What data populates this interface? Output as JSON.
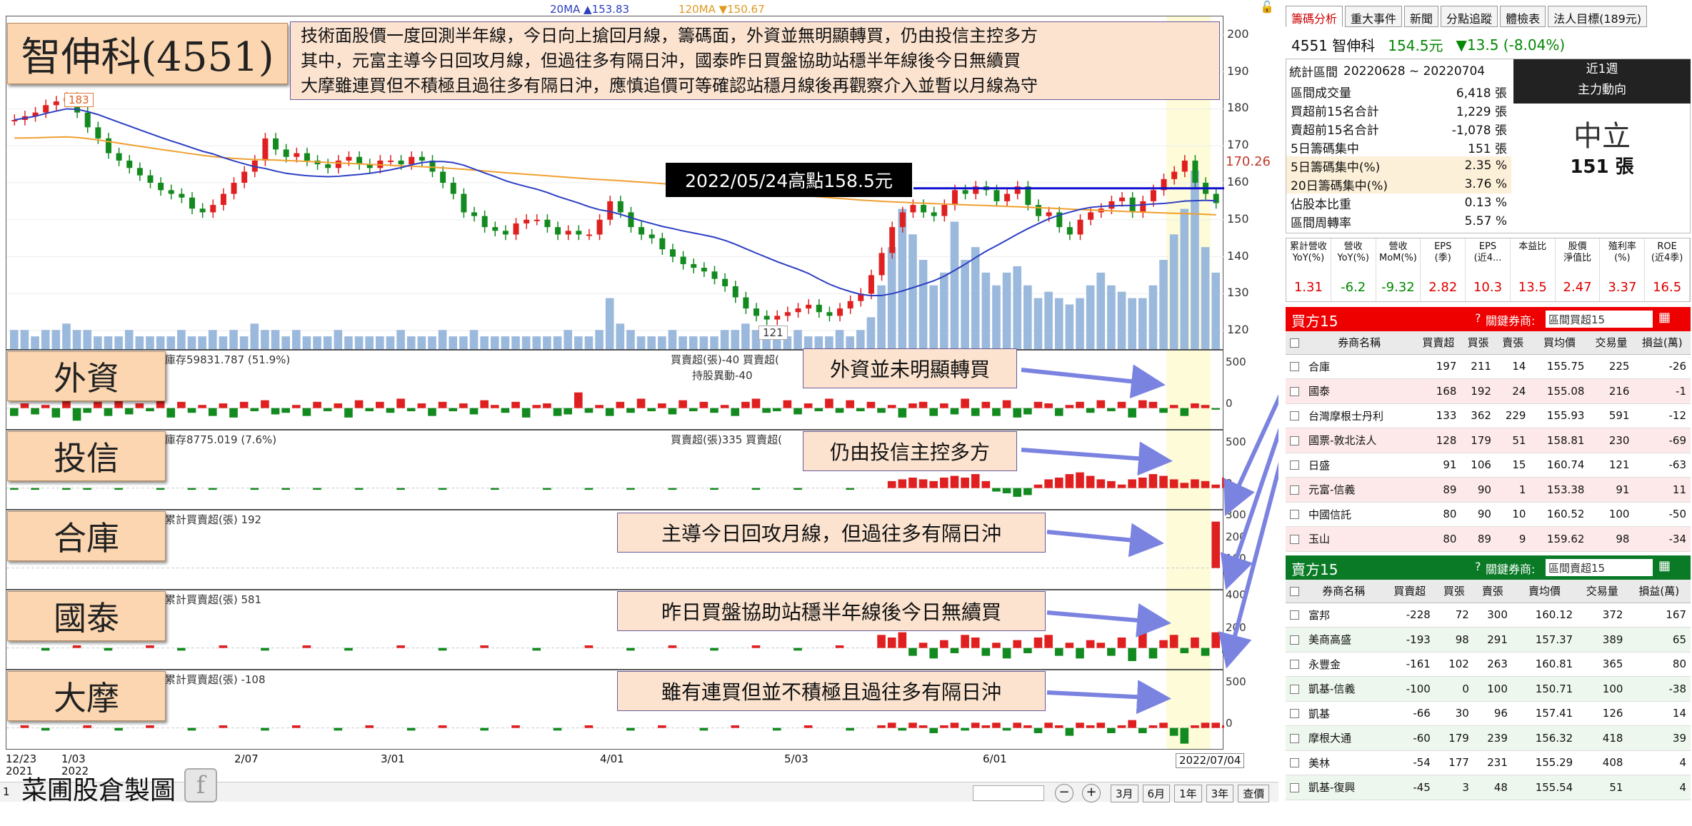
{
  "title": "智伸科(4551)",
  "commentary": [
    "技術面股價一度回測半年線，今日向上搶回月線，籌碼面，外資並無明顯轉買，仍由投信主控多方",
    "其中，元富主導今日回攻月線，但過往多有隔日沖，國泰昨日買盤協助站穩半年線後今日無續買",
    "大摩雖連買但不積極且過往多有隔日沖，應慎追價可等確認站穩月線後再觀察介入並暫以月線為守"
  ],
  "ma_legend": {
    "ma20": "20MA ▲153.83",
    "ma120": "120MA ▼150.67"
  },
  "high_label": "2022/05/24高點158.5元",
  "last_price_tag": "170.26",
  "peak_label": "183",
  "low_label": "121",
  "price_axis": [
    "200",
    "190",
    "180",
    "170",
    "160",
    "150",
    "140",
    "130",
    "120"
  ],
  "date_labels": [
    {
      "d": "12/23\n2021"
    },
    {
      "d": "1/03\n2022"
    },
    {
      "d": "2/07"
    },
    {
      "d": "3/01"
    },
    {
      "d": "4/01"
    },
    {
      "d": "5/03"
    },
    {
      "d": "6/01"
    },
    {
      "d": "2022/07/04"
    }
  ],
  "panels": [
    {
      "badge": "外資",
      "info": "庫存59831.787 (51.9%)",
      "info2": "買賣超(張)-40 買賣超(",
      "info3": "持股異動-40",
      "callout": "外資並未明顯轉買",
      "axis": [
        "500",
        "0"
      ]
    },
    {
      "badge": "投信",
      "info": "庫存8775.019 (7.6%)",
      "info2": "買賣超(張)335 買賣超(",
      "info3": "",
      "callout": "仍由投信主控多方",
      "axis": [
        "500",
        "0"
      ]
    },
    {
      "badge": "合庫",
      "info": "累計買賣超(張) 192",
      "info2": "",
      "info3": "",
      "callout": "主導今日回攻月線，但過往多有隔日沖",
      "axis": [
        "300",
        "200",
        "100",
        "0"
      ]
    },
    {
      "badge": "國泰",
      "info": "累計買賣超(張) 581",
      "info2": "",
      "info3": "",
      "callout": "昨日買盤協助站穩半年線後今日無續買",
      "axis": [
        "400",
        "200",
        "0"
      ]
    },
    {
      "badge": "大摩",
      "info": "累計買賣超(張) -108",
      "info2": "",
      "info3": "",
      "callout": "雖有連買但並不積極且過往多有隔日沖",
      "axis": [
        "500",
        "0"
      ]
    }
  ],
  "footer": {
    "credit": "菜圃股倉製圖",
    "ranges": [
      "3月",
      "6月",
      "1年",
      "3年"
    ],
    "query": "查價",
    "page": "1"
  },
  "right": {
    "tabs": [
      "籌碼分析",
      "重大事件",
      "新聞",
      "分點追蹤",
      "體檢表",
      "法人目標(189元)"
    ],
    "stock": "4551 智伸科",
    "price": "154.5元",
    "change": "▼13.5 (-8.04%)",
    "stats_period_label": "統計區間",
    "stats_period": "20220628 ~ 20220704",
    "stats": [
      {
        "k": "區間成交量",
        "v": "6,418 張"
      },
      {
        "k": "買超前15名合計",
        "v": "1,229 張"
      },
      {
        "k": "賣超前15名合計",
        "v": "-1,078 張"
      },
      {
        "k": "5日籌碼集中",
        "v": "151 張"
      },
      {
        "k": "5日籌碼集中(%)",
        "v": "2.35 %"
      },
      {
        "k": "20日籌碼集中(%)",
        "v": "3.76 %"
      },
      {
        "k": "佔股本比重",
        "v": "0.13 %"
      },
      {
        "k": "區間周轉率",
        "v": "5.57 %"
      }
    ],
    "trend_box": {
      "head1": "近1週",
      "head2": "主力動向",
      "value": "中立",
      "shares": "151 張"
    },
    "metrics": [
      {
        "h": "累計營收\nYoY(%)",
        "v": "1.31"
      },
      {
        "h": "營收\nYoY(%)",
        "v": "-6.2"
      },
      {
        "h": "營收\nMoM(%)",
        "v": "-9.32"
      },
      {
        "h": "EPS\n(季)",
        "v": "2.82"
      },
      {
        "h": "EPS\n(近4...",
        "v": "10.3"
      },
      {
        "h": "本益比",
        "v": "13.5"
      },
      {
        "h": "股價\n淨值比",
        "v": "2.47"
      },
      {
        "h": "殖利率\n(%)",
        "v": "3.37"
      },
      {
        "h": "ROE\n(近4季)",
        "v": "16.5"
      }
    ],
    "buy_title": "買方15",
    "sell_title": "賣方15",
    "broker_label": "關鍵券商:",
    "buy_select": "區間買超15",
    "sell_select": "區間賣超15",
    "buy_headers": [
      "券商名稱",
      "買賣超",
      "買張",
      "賣張",
      "買均價",
      "交易量",
      "損益(萬)"
    ],
    "sell_headers": [
      "券商名稱",
      "買賣超",
      "買張",
      "賣張",
      "賣均價",
      "交易量",
      "損益(萬)"
    ],
    "buy_rows": [
      [
        "合庫",
        "197",
        "211",
        "14",
        "155.75",
        "225",
        "-26"
      ],
      [
        "國泰",
        "168",
        "192",
        "24",
        "155.08",
        "216",
        "-1"
      ],
      [
        "台灣摩根士丹利",
        "133",
        "362",
        "229",
        "155.93",
        "591",
        "-12"
      ],
      [
        "國票-敦北法人",
        "128",
        "179",
        "51",
        "158.81",
        "230",
        "-69"
      ],
      [
        "日盛",
        "91",
        "106",
        "15",
        "160.74",
        "121",
        "-63"
      ],
      [
        "元富-信義",
        "89",
        "90",
        "1",
        "153.38",
        "91",
        "11"
      ],
      [
        "中國信託",
        "80",
        "90",
        "10",
        "160.52",
        "100",
        "-50"
      ],
      [
        "玉山",
        "80",
        "89",
        "9",
        "159.62",
        "98",
        "-34"
      ]
    ],
    "sell_rows": [
      [
        "富邦",
        "-228",
        "72",
        "300",
        "160.12",
        "372",
        "167"
      ],
      [
        "美商高盛",
        "-193",
        "98",
        "291",
        "157.37",
        "389",
        "65"
      ],
      [
        "永豐金",
        "-161",
        "102",
        "263",
        "160.81",
        "365",
        "80"
      ],
      [
        "凱基-信義",
        "-100",
        "0",
        "100",
        "150.71",
        "100",
        "-38"
      ],
      [
        "凱基",
        "-66",
        "30",
        "96",
        "157.41",
        "126",
        "14"
      ],
      [
        "摩根大通",
        "-60",
        "179",
        "239",
        "156.32",
        "418",
        "39"
      ],
      [
        "美林",
        "-54",
        "177",
        "231",
        "155.29",
        "408",
        "4"
      ],
      [
        "凱基-復興",
        "-45",
        "3",
        "48",
        "155.54",
        "51",
        "4"
      ]
    ]
  },
  "chart_data": {
    "type": "candlestick",
    "title": "智伸科(4551)",
    "ylim": [
      115,
      205
    ],
    "ma20_last": 153.83,
    "ma120_last": 150.67,
    "annotations": [
      "2022/05/24高點158.5元",
      "183",
      "121"
    ],
    "price_close": [
      177,
      178,
      179,
      181,
      182,
      183,
      179,
      175,
      172,
      168,
      166,
      164,
      162,
      160,
      158,
      157,
      156,
      153,
      152,
      154,
      157,
      160,
      163,
      166,
      172,
      169,
      167,
      168,
      166,
      165,
      164,
      166,
      167,
      165,
      164,
      166,
      166,
      165,
      167,
      166,
      163,
      160,
      157,
      152,
      151,
      148,
      147,
      146,
      149,
      150,
      150,
      148,
      146,
      147,
      146,
      146,
      150,
      155,
      152,
      148,
      146,
      145,
      142,
      140,
      138,
      137,
      136,
      134,
      132,
      129,
      126,
      124,
      123,
      124,
      125,
      126,
      127,
      125,
      124,
      126,
      128,
      130,
      135,
      141,
      148,
      152,
      154,
      152,
      151,
      154,
      158,
      157,
      159,
      158,
      155,
      157,
      159,
      154,
      151,
      152,
      148,
      146,
      150,
      152,
      153,
      155,
      156,
      152,
      155,
      158,
      161,
      163,
      166,
      160,
      157,
      154.5
    ],
    "volume": [
      3,
      3,
      2,
      3,
      3,
      4,
      3,
      3,
      2,
      2,
      2,
      3,
      2,
      2,
      2,
      2,
      3,
      2,
      2,
      3,
      2,
      3,
      2,
      4,
      3,
      3,
      2,
      3,
      2,
      2,
      2,
      3,
      2,
      2,
      2,
      2,
      2,
      3,
      2,
      2,
      2,
      3,
      2,
      2,
      3,
      2,
      2,
      2,
      2,
      2,
      2,
      2,
      2,
      3,
      2,
      2,
      3,
      8,
      4,
      3,
      2,
      2,
      2,
      3,
      2,
      2,
      2,
      2,
      3,
      3,
      4,
      3,
      2,
      2,
      2,
      3,
      2,
      2,
      2,
      3,
      2,
      3,
      5,
      10,
      16,
      22,
      18,
      14,
      10,
      12,
      20,
      14,
      16,
      12,
      10,
      12,
      13,
      10,
      8,
      9,
      8,
      7,
      8,
      10,
      12,
      10,
      9,
      8,
      8,
      10,
      14,
      18,
      22,
      28,
      16,
      12
    ],
    "series": [
      {
        "name": "外資",
        "values": [
          -5,
          3,
          -4,
          2,
          -6,
          5,
          -8,
          -3,
          4,
          -5,
          6,
          -4,
          3,
          -2,
          5,
          -6,
          4,
          -3,
          2,
          -5,
          3,
          -6,
          4,
          -2,
          5,
          -4,
          -3,
          2,
          -5,
          4,
          -2,
          3,
          -6,
          5,
          -2,
          4,
          -3,
          6,
          -2,
          3,
          -5,
          4,
          -2,
          3,
          -4,
          5,
          2,
          -3,
          4,
          -6,
          2,
          3,
          -5,
          -4,
          10,
          -3,
          2,
          -5,
          4,
          -3,
          6,
          -2,
          3,
          -4,
          5,
          -2,
          4,
          -3,
          2,
          -5,
          4,
          6,
          -3,
          -2,
          5,
          -4,
          3,
          -2,
          6,
          -3,
          5,
          -2,
          4,
          -3,
          2,
          -6,
          3,
          4,
          -5,
          3,
          -4,
          6,
          -5,
          4,
          -5,
          5,
          -6,
          -4,
          4,
          3,
          -5,
          2,
          4,
          -3,
          5,
          -2,
          4,
          -6,
          5,
          4,
          -3,
          2,
          -5,
          3,
          2,
          -1
        ]
      },
      {
        "name": "投信",
        "values": [
          -1,
          0,
          -1,
          0,
          0,
          -1,
          0,
          -1,
          0,
          0,
          -1,
          0,
          0,
          0,
          -1,
          0,
          0,
          -1,
          0,
          -1,
          0,
          0,
          0,
          -1,
          0,
          0,
          -1,
          0,
          0,
          -1,
          0,
          0,
          0,
          -1,
          0,
          0,
          0,
          -1,
          0,
          0,
          0,
          -1,
          0,
          0,
          0,
          0,
          -1,
          0,
          0,
          0,
          0,
          -1,
          0,
          0,
          0,
          -1,
          0,
          0,
          0,
          -1,
          0,
          0,
          0,
          -1,
          0,
          0,
          0,
          -1,
          0,
          0,
          0,
          -1,
          0,
          0,
          0,
          -1,
          0,
          0,
          0,
          0,
          -1,
          0,
          0,
          0,
          4,
          5,
          6,
          5,
          4,
          6,
          7,
          6,
          8,
          4,
          -2,
          -3,
          -5,
          -4,
          2,
          5,
          6,
          8,
          9,
          7,
          5,
          4,
          2,
          5,
          6,
          8,
          7,
          5,
          3,
          5,
          4,
          2,
          6
        ]
      },
      {
        "name": "合庫",
        "values": [
          0,
          0,
          0,
          0,
          0,
          0,
          0,
          0,
          0,
          0,
          0,
          0,
          0,
          0,
          0,
          0,
          0,
          0,
          0,
          0,
          0,
          0,
          0,
          0,
          0,
          0,
          0,
          0,
          0,
          0,
          0,
          0,
          0,
          0,
          0,
          0,
          0,
          0,
          0,
          0,
          0,
          0,
          0,
          0,
          0,
          0,
          0,
          0,
          0,
          0,
          0,
          0,
          0,
          0,
          0,
          0,
          0,
          0,
          0,
          0,
          0,
          0,
          0,
          0,
          0,
          0,
          0,
          0,
          0,
          0,
          0,
          0,
          0,
          0,
          0,
          0,
          0,
          0,
          0,
          0,
          0,
          0,
          0,
          0,
          0,
          0,
          0,
          0,
          0,
          0,
          0,
          0,
          0,
          0,
          0,
          0,
          0,
          0,
          0,
          0,
          0,
          0,
          0,
          0,
          0,
          0,
          0,
          0,
          0,
          0,
          0,
          0,
          0,
          0,
          0,
          192
        ]
      },
      {
        "name": "國泰",
        "values": [
          0,
          0,
          0,
          -1,
          0,
          0,
          1,
          0,
          0,
          -1,
          0,
          0,
          0,
          1,
          0,
          0,
          -1,
          0,
          0,
          0,
          1,
          0,
          0,
          0,
          -1,
          0,
          0,
          0,
          1,
          0,
          0,
          0,
          -1,
          0,
          0,
          0,
          0,
          1,
          0,
          0,
          0,
          -1,
          0,
          0,
          0,
          1,
          0,
          0,
          0,
          0,
          -1,
          0,
          0,
          0,
          0,
          1,
          0,
          0,
          0,
          -1,
          0,
          0,
          0,
          1,
          0,
          0,
          0,
          -1,
          0,
          0,
          0,
          1,
          0,
          0,
          0,
          -1,
          0,
          0,
          0,
          1,
          0,
          0,
          0,
          5,
          4,
          6,
          -3,
          2,
          -4,
          3,
          -2,
          5,
          4,
          -3,
          2,
          -4,
          3,
          -2,
          4,
          5,
          -3,
          2,
          -4,
          3,
          2,
          -3,
          4,
          -5,
          6,
          -4,
          3,
          5,
          -2,
          4,
          -3,
          6,
          -2,
          0
        ]
      },
      {
        "name": "大摩",
        "values": [
          0,
          1,
          0,
          -1,
          0,
          0,
          0,
          1,
          0,
          0,
          -1,
          0,
          0,
          1,
          0,
          0,
          0,
          -1,
          0,
          0,
          1,
          0,
          0,
          0,
          -1,
          0,
          0,
          1,
          0,
          0,
          0,
          -1,
          0,
          0,
          1,
          0,
          0,
          0,
          -1,
          0,
          0,
          1,
          0,
          0,
          0,
          -1,
          0,
          0,
          1,
          0,
          0,
          0,
          -1,
          0,
          0,
          1,
          0,
          0,
          0,
          -1,
          0,
          0,
          1,
          0,
          0,
          0,
          -1,
          0,
          0,
          1,
          0,
          0,
          0,
          -1,
          0,
          0,
          1,
          0,
          0,
          0,
          -1,
          0,
          0,
          1,
          2,
          -1,
          2,
          1,
          -2,
          1,
          2,
          -1,
          2,
          1,
          2,
          -1,
          2,
          1,
          -2,
          2,
          1,
          -3,
          2,
          1,
          2,
          -2,
          1,
          3,
          -2,
          1,
          2,
          -3,
          -6,
          1,
          2,
          2,
          1,
          -1
        ]
      }
    ]
  }
}
